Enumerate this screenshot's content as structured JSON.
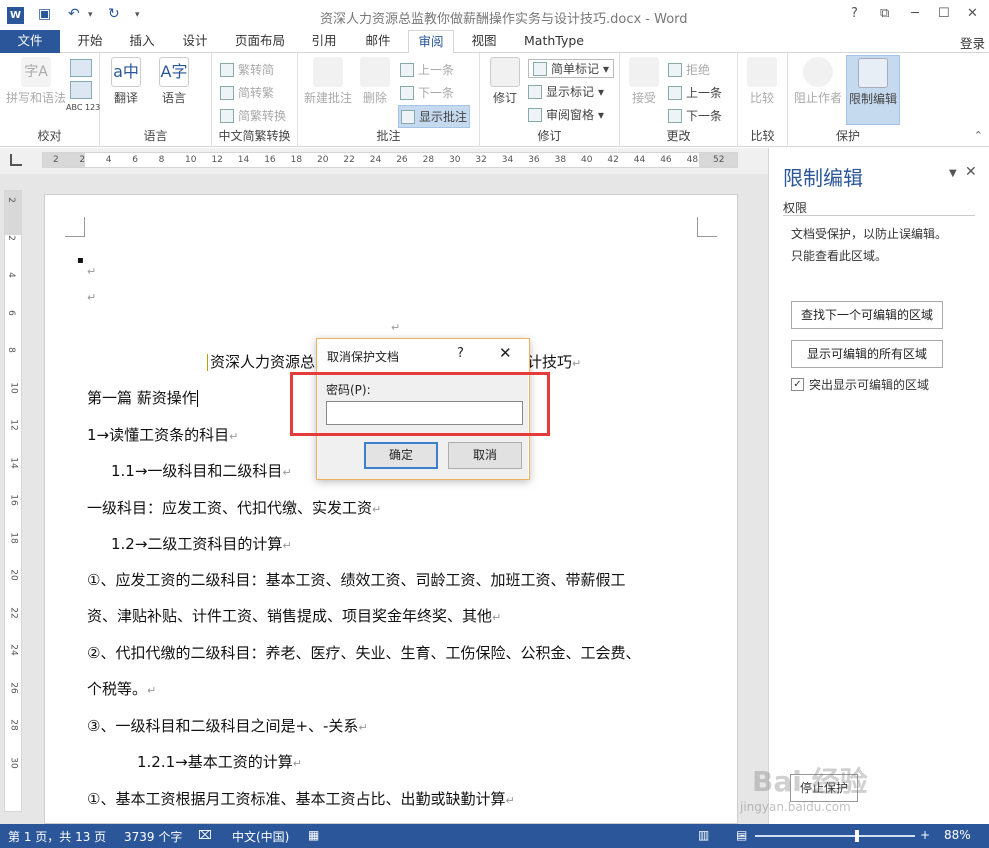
{
  "window": {
    "title": "资深人力资源总监教你做薪酬操作实务与设计技巧.docx - Word",
    "help": "?",
    "restore": "⧉",
    "minimize": "─",
    "maximize": "☐",
    "close": "✕",
    "login": "登录"
  },
  "quick_access": {
    "word_logo": "W"
  },
  "tabs": [
    "文件",
    "开始",
    "插入",
    "设计",
    "页面布局",
    "引用",
    "邮件",
    "审阅",
    "视图",
    "MathType"
  ],
  "active_tab": "审阅",
  "ribbon": {
    "proofing": {
      "label": "校对",
      "spell": "拼写和语法",
      "spell_icon_text": "字A",
      "abc": "ABC 123"
    },
    "language": {
      "label": "语言",
      "translate": "翻译",
      "language": "语言"
    },
    "chinese": {
      "label": "中文简繁转换",
      "to_simplified": "繁转简",
      "to_traditional": "简转繁",
      "convert": "简繁转换"
    },
    "comments": {
      "label": "批注",
      "new": "新建批注",
      "delete": "删除",
      "prev": "上一条",
      "next": "下一条",
      "show": "显示批注"
    },
    "tracking": {
      "label": "修订",
      "track": "修订",
      "simple_markup": "简单标记",
      "show_markup": "显示标记",
      "review_pane": "审阅窗格"
    },
    "changes": {
      "label": "更改",
      "accept": "接受",
      "reject": "拒绝",
      "prev": "上一条",
      "next": "下一条"
    },
    "compare": {
      "label": "比较",
      "compare": "比较"
    },
    "protect": {
      "label": "保护",
      "block_authors": "阻止作者",
      "restrict": "限制编辑"
    }
  },
  "ruler": {
    "marks": [
      "2",
      "2",
      "4",
      "6",
      "8",
      "10",
      "12",
      "14",
      "16",
      "18",
      "20",
      "22",
      "24",
      "26",
      "28",
      "30",
      "32",
      "34",
      "36",
      "38",
      "40",
      "42",
      "44",
      "46",
      "48",
      "52"
    ],
    "vmarks": [
      "2",
      "2",
      "4",
      "6",
      "8",
      "10",
      "12",
      "14",
      "16",
      "18",
      "20",
      "22",
      "24",
      "26",
      "28",
      "30"
    ]
  },
  "document": {
    "bullet": "▪",
    "para_mark": "↵",
    "title_line": "资深人力资源总",
    "title_tail": "计技巧",
    "lines": [
      "第一篇 薪资操作",
      "1→读懂工资条的科目",
      "1.1→一级科目和二级科目",
      "一级科目：应发工资、代扣代缴、实发工资",
      "1.2→二级工资科目的计算",
      "①、应发工资的二级科目：基本工资、绩效工资、司龄工资、加班工资、带薪假工",
      "资、津贴补贴、计件工资、销售提成、项目奖金年终奖、其他",
      "②、代扣代缴的二级科目：养老、医疗、失业、生育、工伤保险、公积金、工会费、",
      "个税等。",
      "③、一级科目和二级科目之间是+、-关系",
      "1.2.1→基本工资的计算",
      "①、基本工资根据月工资标准、基本工资占比、出勤或缺勤计算"
    ]
  },
  "pane": {
    "title": "限制编辑",
    "dropdown": "▼",
    "close": "✕",
    "section": "权限",
    "text1": "文档受保护，以防止误编辑。",
    "text2": "只能查看此区域。",
    "find_next": "查找下一个可编辑的区域",
    "show_all": "显示可编辑的所有区域",
    "highlight": "突出显示可编辑的区域",
    "highlight_checked": true,
    "stop_protection": "停止保护"
  },
  "dialog": {
    "title": "取消保护文档",
    "help": "?",
    "close": "✕",
    "password_label": "密码(P):",
    "password_value": "",
    "ok": "确定",
    "cancel": "取消"
  },
  "status": {
    "page": "第 1 页，共 13 页",
    "words": "3739 个字",
    "language": "中文(中国)",
    "zoom": "88%",
    "zoom_minus": "-",
    "zoom_plus": "+"
  },
  "watermark": {
    "brand": "Bai 经验",
    "url": "jingyan.baidu.com"
  },
  "colors": {
    "accent": "#2b579a",
    "highlight_box": "#e53b3b",
    "dialog_border": "#f0b060"
  }
}
